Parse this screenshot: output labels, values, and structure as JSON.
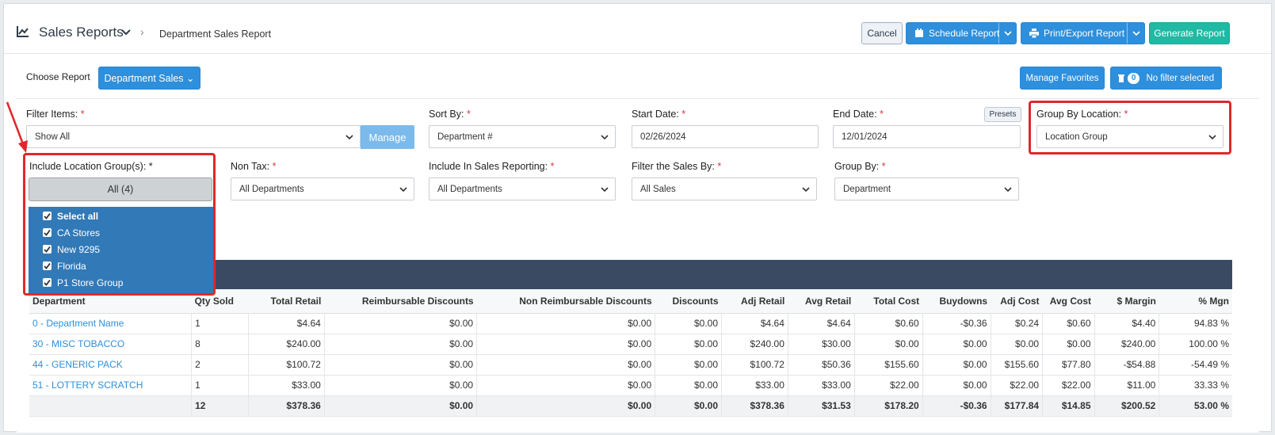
{
  "header": {
    "title": "Sales Reports",
    "breadcrumb": "Department Sales Report",
    "cancel_label": "Cancel",
    "schedule_label": "Schedule Report",
    "print_label": "Print/Export Report",
    "generate_label": "Generate Report"
  },
  "toolbar": {
    "choose_label": "Choose Report",
    "report_select": "Department Sales ⌄",
    "favorites_label": "Manage Favorites",
    "filter_count": "0",
    "filter_label": "No filter selected"
  },
  "filters": {
    "filter_items": {
      "label": "Filter Items:",
      "value": "Show All",
      "manage_label": "Manage"
    },
    "sort_by": {
      "label": "Sort By:",
      "value": "Department #"
    },
    "start_date": {
      "label": "Start Date:",
      "value": "02/26/2024"
    },
    "end_date": {
      "label": "End Date:",
      "value": "12/01/2024",
      "presets_label": "Presets"
    },
    "group_by_location": {
      "label": "Group By Location:",
      "value": "Location Group"
    },
    "include_location_groups": {
      "label": "Include Location Group(s):",
      "value": "All (4)"
    },
    "non_tax": {
      "label": "Non Tax:",
      "value": "All Departments"
    },
    "include_in_sales": {
      "label": "Include In Sales Reporting:",
      "value": "All Departments"
    },
    "filter_sales_by": {
      "label": "Filter the Sales By:",
      "value": "All Sales"
    },
    "group_by": {
      "label": "Group By:",
      "value": "Department"
    }
  },
  "location_dropdown": {
    "items": [
      "Select all",
      "CA Stores",
      "New 9295",
      "Florida",
      "P1 Store Group"
    ]
  },
  "table": {
    "headers": [
      "Department",
      "Qty Sold",
      "Total Retail",
      "Reimbursable Discounts",
      "Non Reimbursable Discounts",
      "Discounts",
      "Adj Retail",
      "Avg Retail",
      "Total Cost",
      "Buydowns",
      "Adj Cost",
      "Avg Cost",
      "$ Margin",
      "% Mgn"
    ],
    "rows": [
      [
        "0 - Department Name",
        "1",
        "$4.64",
        "$0.00",
        "$0.00",
        "$0.00",
        "$4.64",
        "$4.64",
        "$0.60",
        "-$0.36",
        "$0.24",
        "$0.60",
        "$4.40",
        "94.83 %"
      ],
      [
        "30 - MISC TOBACCO",
        "8",
        "$240.00",
        "$0.00",
        "$0.00",
        "$0.00",
        "$240.00",
        "$30.00",
        "$0.00",
        "$0.00",
        "$0.00",
        "$0.00",
        "$240.00",
        "100.00 %"
      ],
      [
        "44 - GENERIC PACK",
        "2",
        "$100.72",
        "$0.00",
        "$0.00",
        "$0.00",
        "$100.72",
        "$50.36",
        "$155.60",
        "$0.00",
        "$155.60",
        "$77.80",
        "-$54.88",
        "-54.49 %"
      ],
      [
        "51 - LOTTERY SCRATCH",
        "1",
        "$33.00",
        "$0.00",
        "$0.00",
        "$0.00",
        "$33.00",
        "$33.00",
        "$22.00",
        "$0.00",
        "$22.00",
        "$22.00",
        "$11.00",
        "33.33 %"
      ]
    ],
    "totals": [
      "",
      "12",
      "$378.36",
      "$0.00",
      "$0.00",
      "$0.00",
      "$378.36",
      "$31.53",
      "$178.20",
      "-$0.36",
      "$177.84",
      "$14.85",
      "$200.52",
      "53.00 %"
    ]
  },
  "colors": {
    "primary": "#2e8fdc",
    "teal": "#1fb9a4",
    "annotation_red": "#e0282c",
    "table_bar": "#3a4a63",
    "dropdown": "#3279b7"
  }
}
